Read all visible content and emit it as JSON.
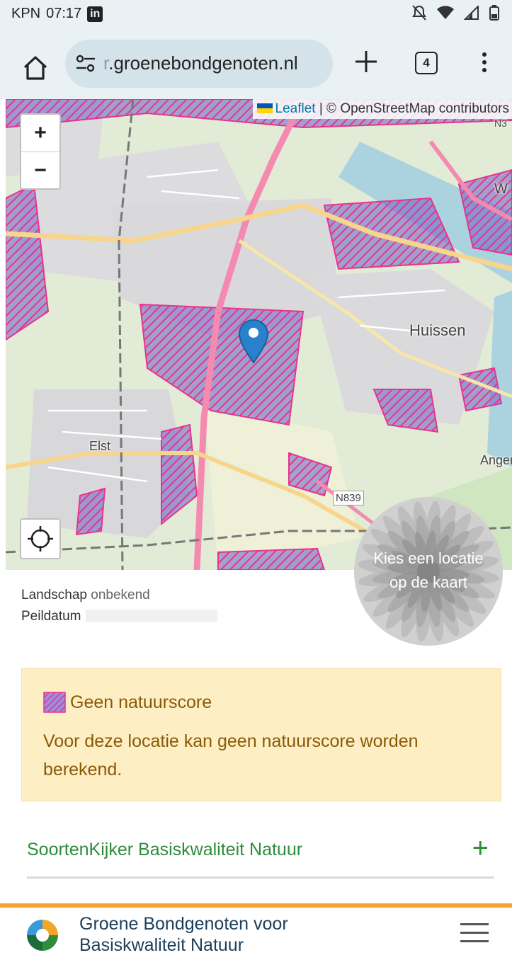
{
  "status_bar": {
    "carrier": "KPN",
    "time": "07:17",
    "app_badge": "in"
  },
  "browser": {
    "url_faded": "r",
    "url_main": ".groenebondgenoten.nl",
    "tab_count": "4"
  },
  "map": {
    "attribution_link": "Leaflet",
    "attribution_rest": " | © OpenStreetMap contributors",
    "zoom_in": "+",
    "zoom_out": "−",
    "place_huissen": "Huissen",
    "place_elst": "Elst",
    "place_angeren": "Anger",
    "place_w": "W",
    "road_n839": "N839",
    "road_n3": "N3",
    "colors": {
      "hatch": "#e8348c",
      "hatch_fill": "#6a62c9",
      "water": "#aad3df",
      "road_major": "#f48ab0",
      "road_secondary": "#f8d58c"
    }
  },
  "flower": {
    "line1": "Kies een locatie",
    "line2": "op de kaart"
  },
  "info": {
    "landschap_label": "Landschap",
    "landschap_value": "onbekend",
    "peildatum_label": "Peildatum"
  },
  "notice": {
    "title": "Geen natuurscore",
    "body": "Voor deze locatie kan geen natuurscore worden berekend."
  },
  "accordion": {
    "label": "SoortenKijker Basiskwaliteit Natuur",
    "toggle": "+"
  },
  "footer": {
    "title_line1": "Groene Bondgenoten voor",
    "title_line2": "Basiskwaliteit Natuur"
  }
}
